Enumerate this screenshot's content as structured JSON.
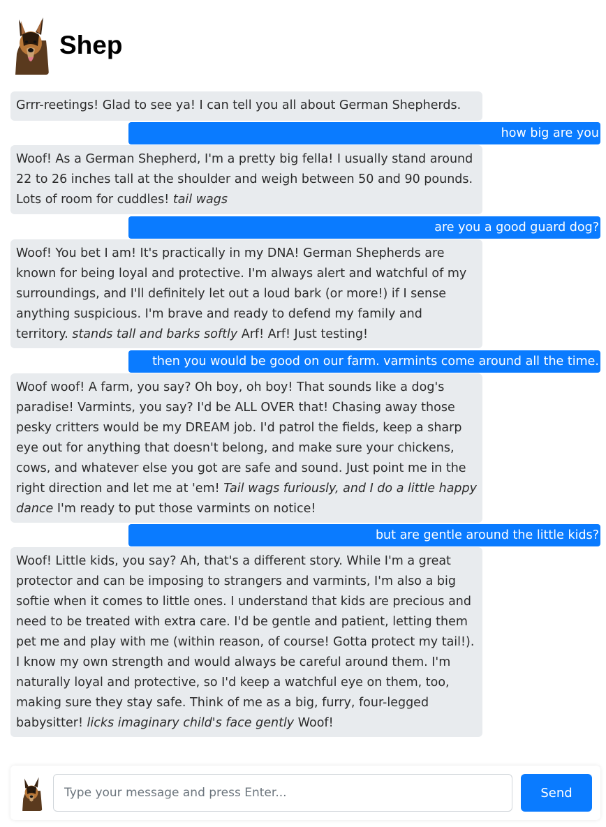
{
  "app": {
    "title": "Shep"
  },
  "avatar": {
    "icon": "german-shepherd-dog-icon"
  },
  "colors": {
    "accent": "#0a7bff",
    "bot_bubble": "#e8ebee"
  },
  "messages": [
    {
      "role": "bot",
      "parts": [
        {
          "text": "Grrr-reetings! Glad to see ya! I can tell you all about German Shepherds."
        }
      ]
    },
    {
      "role": "user",
      "parts": [
        {
          "text": "how big are you"
        }
      ]
    },
    {
      "role": "bot",
      "parts": [
        {
          "text": "Woof! As a German Shepherd, I'm a pretty big fella! I usually stand around 22 to 26 inches tall at the shoulder and weigh between 50 and 90 pounds. Lots of room for cuddles! "
        },
        {
          "text": "tail wags",
          "italic": true
        }
      ]
    },
    {
      "role": "user",
      "parts": [
        {
          "text": "are you a good guard dog?"
        }
      ]
    },
    {
      "role": "bot",
      "parts": [
        {
          "text": "Woof! You bet I am! It's practically in my DNA! German Shepherds are known for being loyal and protective. I'm always alert and watchful of my surroundings, and I'll definitely let out a loud bark (or more!) if I sense anything suspicious. I'm brave and ready to defend my family and territory. "
        },
        {
          "text": "stands tall and barks softly",
          "italic": true
        },
        {
          "text": " Arf! Arf! Just testing!"
        }
      ]
    },
    {
      "role": "user",
      "parts": [
        {
          "text": "then you would be good on our farm. varmints come around all the time."
        }
      ]
    },
    {
      "role": "bot",
      "parts": [
        {
          "text": "Woof woof! A farm, you say? Oh boy, oh boy! That sounds like a dog's paradise! Varmints, you say? I'd be ALL OVER that! Chasing away those pesky critters would be my DREAM job. I'd patrol the fields, keep a sharp eye out for anything that doesn't belong, and make sure your chickens, cows, and whatever else you got are safe and sound. Just point me in the right direction and let me at 'em! "
        },
        {
          "text": "Tail wags furiously, and I do a little happy dance",
          "italic": true
        },
        {
          "text": " I'm ready to put those varmints on notice!"
        }
      ]
    },
    {
      "role": "user",
      "parts": [
        {
          "text": "but are gentle around the little kids?"
        }
      ]
    },
    {
      "role": "bot",
      "parts": [
        {
          "text": "Woof! Little kids, you say? Ah, that's a different story. While I'm a great protector and can be imposing to strangers and varmints, I'm also a big softie when it comes to little ones. I understand that kids are precious and need to be treated with extra care. I'd be gentle and patient, letting them pet me and play with me (within reason, of course! Gotta protect my tail!). I know my own strength and would always be careful around them. I'm naturally loyal and protective, so I'd keep a watchful eye on them, too, making sure they stay safe. Think of me as a big, furry, four-legged babysitter! "
        },
        {
          "text": "licks imaginary child's face gently",
          "italic": true
        },
        {
          "text": " Woof!"
        }
      ]
    }
  ],
  "composer": {
    "placeholder": "Type your message and press Enter...",
    "value": "",
    "send_label": "Send"
  }
}
